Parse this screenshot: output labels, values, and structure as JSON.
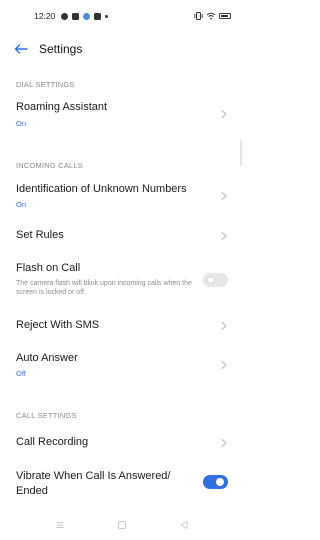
{
  "status_bar": {
    "time": "12:20",
    "icons_left": [
      "facebook-icon",
      "gallery-icon",
      "app-icon",
      "notification-icon"
    ],
    "icons_right": [
      "vibrate-icon",
      "wifi-icon",
      "battery-icon"
    ]
  },
  "header": {
    "title": "Settings",
    "back_icon": "arrow-left-icon"
  },
  "sections": {
    "dial": {
      "heading": "DIAL SETTINGS"
    },
    "incoming": {
      "heading": "INCOMING CALLS"
    },
    "call": {
      "heading": "CALL SETTINGS"
    }
  },
  "rows": {
    "roaming": {
      "title": "Roaming Assistant",
      "value": "On"
    },
    "identification": {
      "title": "Identification of Unknown Numbers",
      "value": "On"
    },
    "set_rules": {
      "title": "Set Rules"
    },
    "flash": {
      "title": "Flash on Call",
      "description": "The camera flash will blink upon incoming calls when the screen is locked or off.",
      "enabled": false
    },
    "reject_sms": {
      "title": "Reject With SMS"
    },
    "auto_answer": {
      "title": "Auto Answer",
      "value": "Off"
    },
    "call_recording": {
      "title": "Call Recording"
    },
    "vibrate": {
      "title_line1": "Vibrate When Call Is Answered/",
      "title_line2": "Ended",
      "enabled": true
    }
  },
  "colors": {
    "accent": "#2f6fe0",
    "value_text": "#3b6fcf",
    "section_text": "#8a8a8a"
  },
  "nav_bar": [
    "menu-icon",
    "home-icon",
    "back-icon"
  ]
}
